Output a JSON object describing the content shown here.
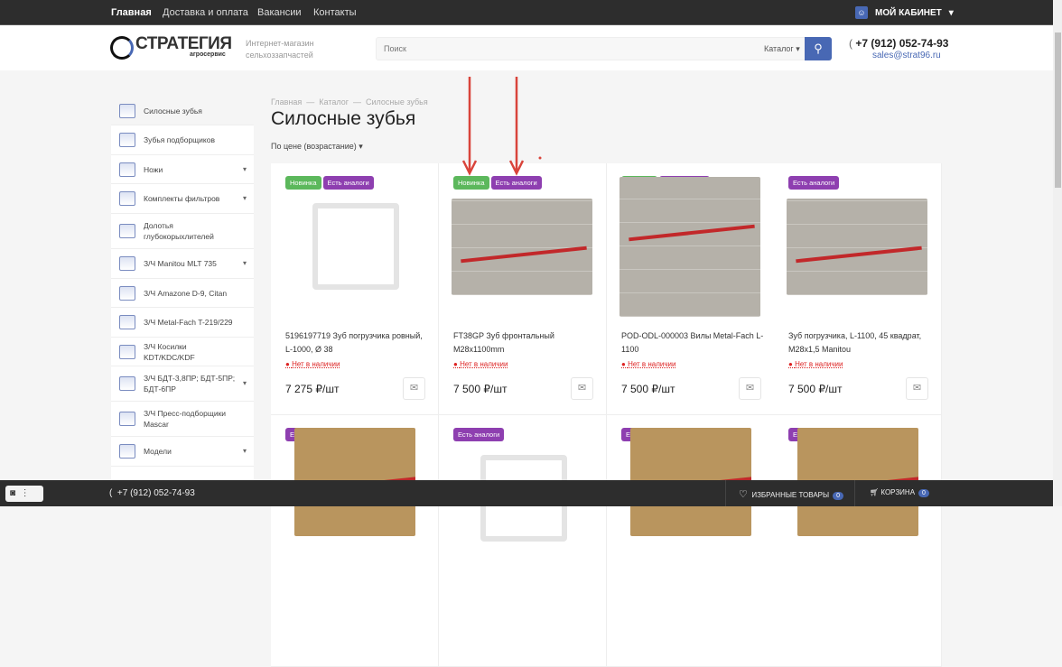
{
  "topnav": {
    "items": [
      "Главная",
      "Доставка и оплата",
      "Вакансии",
      "Контакты"
    ],
    "cabinet": "МОЙ КАБИНЕТ"
  },
  "header": {
    "logo": "СТРАТЕГИЯ",
    "logo_sub": "агросервис",
    "tagline1": "Интернет-магазин",
    "tagline2": "сельхоззапчастей",
    "search_placeholder": "Поиск",
    "search_scope": "Каталог",
    "phone": "+7 (912) 052-74-93",
    "email": "sales@strat96.ru"
  },
  "sidebar": {
    "items": [
      {
        "label": "Силосные зубья",
        "arrow": false
      },
      {
        "label": "Зубья подборщиков",
        "arrow": false
      },
      {
        "label": "Ножи",
        "arrow": true
      },
      {
        "label": "Комплекты фильтров",
        "arrow": true
      },
      {
        "label": "Долотья глубокорыхлителей",
        "arrow": false
      },
      {
        "label": "З/Ч Manitou MLT 735",
        "arrow": true
      },
      {
        "label": "З/Ч Amazone D-9, Citan",
        "arrow": false
      },
      {
        "label": "З/Ч Metal-Fach T-219/229",
        "arrow": false
      },
      {
        "label": "З/Ч Косилки KDT/KDC/KDF",
        "arrow": false
      },
      {
        "label": "З/Ч БДТ-3,8ПР; БДТ-5ПР; БДТ-6ПР",
        "arrow": true
      },
      {
        "label": "З/Ч Пресс-подборщики Mascar",
        "arrow": false
      },
      {
        "label": "Модели",
        "arrow": true
      }
    ]
  },
  "breadcrumb": [
    "Главная",
    "Каталог",
    "Силосные зубья"
  ],
  "page_title": "Силосные зубья",
  "sort": "По цене (возрастание)",
  "badges": {
    "new": "Новинка",
    "analog": "Есть аналоги"
  },
  "products": [
    {
      "name": "5196197719 Зуб погрузчика ровный, L-1000, Ø 38",
      "stock": "Нет в наличии",
      "price": "7 275 ₽/шт"
    },
    {
      "name": "FT38GP Зуб фронтальный M28x1100mm",
      "stock": "Нет в наличии",
      "price": "7 500 ₽/шт"
    },
    {
      "name": "POD-ODL-000003 Вилы Metal-Fach L-1100",
      "stock": "Нет в наличии",
      "price": "7 500 ₽/шт"
    },
    {
      "name": "Зуб погрузчика, L-1100, 45 квадрат, M28x1,5 Manitou",
      "stock": "Нет в наличии",
      "price": "7 500 ₽/шт"
    }
  ],
  "bottombar": {
    "phone": "+7 (912) 052-74-93",
    "favorites": "ИЗБРАННЫЕ ТОВАРЫ",
    "favorites_count": "0",
    "cart": "КОРЗИНА",
    "cart_count": "0"
  },
  "colors": {
    "accent": "#4868b4",
    "new": "#5cb85c",
    "analog": "#8e3fb0",
    "out_of_stock": "#dd2222",
    "annotation": "#d9443b"
  }
}
